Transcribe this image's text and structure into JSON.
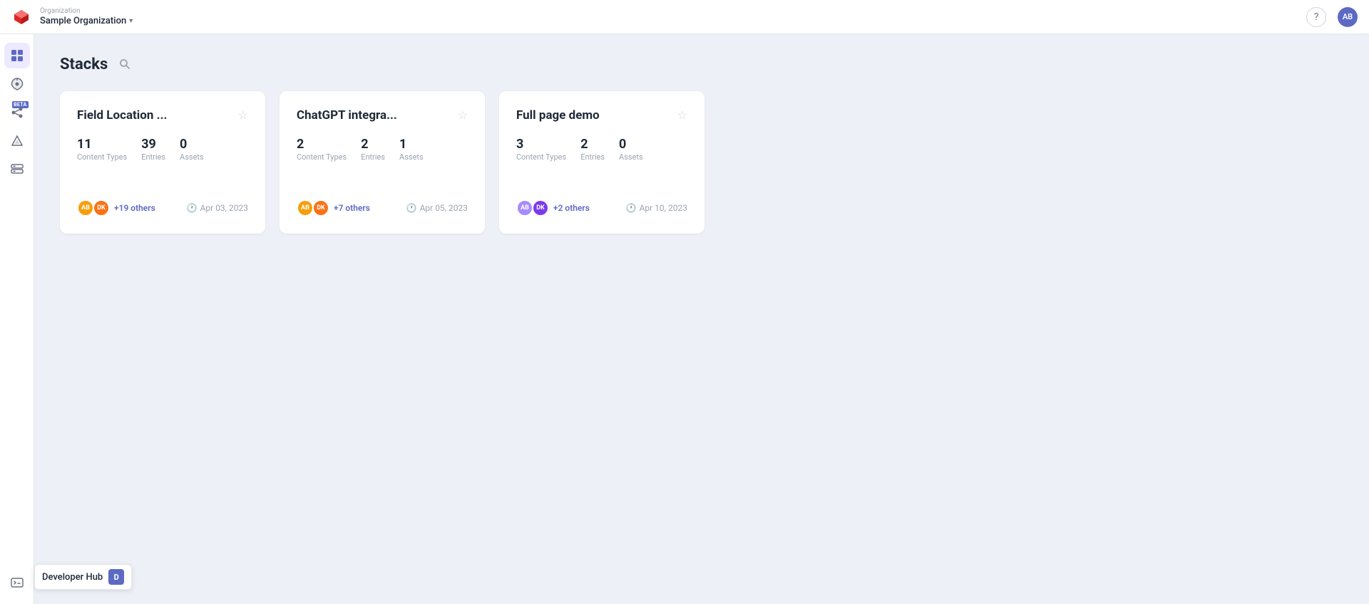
{
  "header": {
    "org_label": "Organization",
    "org_name": "Sample Organization",
    "help_label": "?",
    "avatar_initials": "AB"
  },
  "sidebar": {
    "items": [
      {
        "id": "grid",
        "icon": "grid",
        "active": true,
        "label": "Stacks"
      },
      {
        "id": "launch",
        "icon": "launch",
        "active": false,
        "label": "Launch"
      },
      {
        "id": "api",
        "icon": "api",
        "active": false,
        "label": "API (Beta)",
        "beta": true
      },
      {
        "id": "triangle",
        "icon": "triangle",
        "active": false,
        "label": "Triangle"
      },
      {
        "id": "storage",
        "icon": "storage",
        "active": false,
        "label": "Storage"
      }
    ],
    "developer_hub_tooltip": "Developer Hub",
    "developer_hub_badge": "D"
  },
  "stacks_page": {
    "title": "Stacks",
    "cards": [
      {
        "id": "field-location",
        "title": "Field Location ...",
        "content_types": "11",
        "entries": "39",
        "assets": "0",
        "content_types_label": "Content Types",
        "entries_label": "Entries",
        "assets_label": "Assets",
        "avatars": [
          {
            "initials": "AB",
            "bg": "#f59e0b"
          },
          {
            "initials": "DK",
            "bg": "#f97316"
          }
        ],
        "others": "+19 others",
        "date": "Apr 03, 2023"
      },
      {
        "id": "chatgpt-integra",
        "title": "ChatGPT integra...",
        "content_types": "2",
        "entries": "2",
        "assets": "1",
        "content_types_label": "Content Types",
        "entries_label": "Entries",
        "assets_label": "Assets",
        "avatars": [
          {
            "initials": "AB",
            "bg": "#f59e0b"
          },
          {
            "initials": "DK",
            "bg": "#f97316"
          }
        ],
        "others": "+7 others",
        "date": "Apr 05, 2023"
      },
      {
        "id": "full-page-demo",
        "title": "Full page demo",
        "content_types": "3",
        "entries": "2",
        "assets": "0",
        "content_types_label": "Content Types",
        "entries_label": "Entries",
        "assets_label": "Assets",
        "avatars": [
          {
            "initials": "AB",
            "bg": "#a78bfa"
          },
          {
            "initials": "DK",
            "bg": "#7c3aed"
          }
        ],
        "others": "+2 others",
        "date": "Apr 10, 2023"
      }
    ]
  }
}
